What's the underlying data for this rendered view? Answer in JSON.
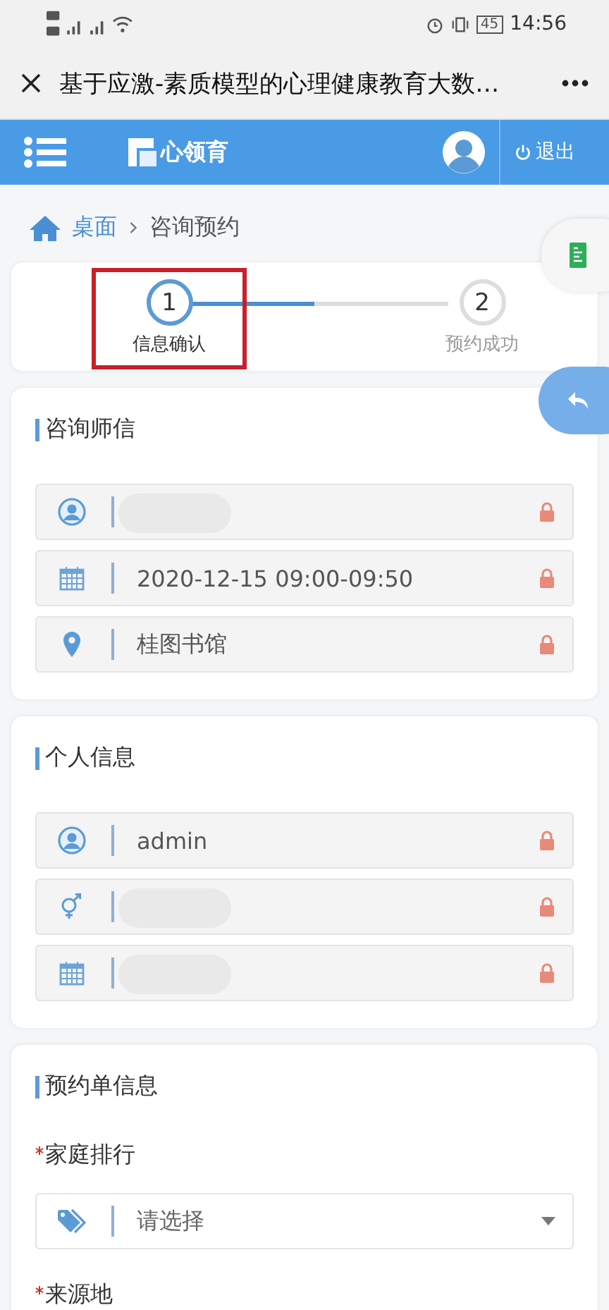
{
  "status_bar": {
    "time": "14:56",
    "battery": "45"
  },
  "title_bar": {
    "title": "基于应激-素质模型的心理健康教育大数…"
  },
  "header": {
    "brand": "心领育",
    "logout": "退出"
  },
  "breadcrumb": [
    {
      "label": "桌面",
      "kind": "link"
    },
    {
      "label": "咨询预约",
      "kind": "current"
    }
  ],
  "steps": {
    "level": 0.5,
    "items": [
      {
        "number": "1",
        "label": "信息确认",
        "selected": true,
        "highlighted": true
      },
      {
        "number": "2",
        "label": "预约成功",
        "selected": false,
        "highlighted": false
      }
    ]
  },
  "sections": [
    {
      "title": "咨询师信",
      "fields": [
        {
          "kind": "person",
          "redacted": true
        },
        {
          "kind": "date",
          "value": "2020-12-15 09:00-09:50",
          "redacted": false
        },
        {
          "kind": "place",
          "value": "桂图书馆",
          "redacted": false
        }
      ]
    },
    {
      "title": "个人信息",
      "fields": [
        {
          "kind": "person",
          "value": "admin",
          "redacted": false
        },
        {
          "kind": "gender",
          "redacted": true
        },
        {
          "kind": "date",
          "redacted": true
        }
      ]
    },
    {
      "title": "预约单信息",
      "fields": [
        {
          "kind": "label",
          "label": "家庭排行",
          "required": true
        },
        {
          "kind": "select",
          "placeholder": "请选择"
        },
        {
          "kind": "label",
          "label": "来源地",
          "required": true
        }
      ]
    }
  ]
}
